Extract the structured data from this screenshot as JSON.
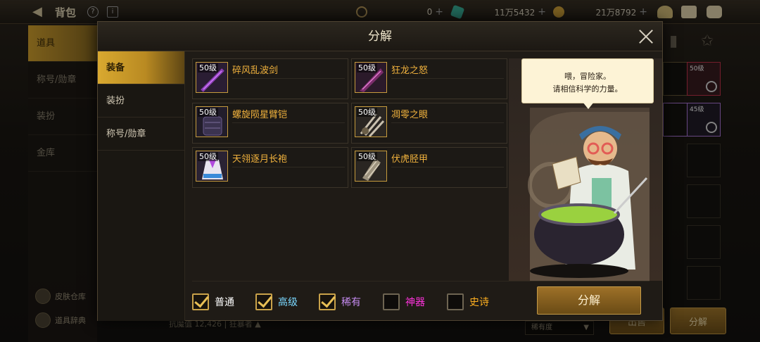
{
  "background": {
    "bag_title": "背包",
    "currency": [
      {
        "value": "0",
        "icon": "crescent-coin-icon",
        "color": "#b89a5a"
      },
      {
        "value": "11万5432",
        "icon": "green-gem-icon",
        "color": "#3ab39b"
      },
      {
        "value": "21万8792",
        "icon": "gold-coin-icon",
        "color": "#d6a53a"
      }
    ],
    "left_nav": [
      "道具",
      "称号/勋章",
      "装扮",
      "金库"
    ],
    "left_nav_bottom": [
      "皮肤仓库",
      "道具辞典"
    ],
    "right_cell_levels": [
      "50级",
      "45级"
    ],
    "bottom_stat": "抗魔值 12,426",
    "bottom_link": "狂暴者",
    "sort_select": "稀有度",
    "bottom_buttons": [
      "出售",
      "分解"
    ]
  },
  "dialog": {
    "title": "分解",
    "side_tabs": [
      {
        "label": "装备",
        "active": true
      },
      {
        "label": "装扮",
        "active": false
      },
      {
        "label": "称号/勋章",
        "active": false
      }
    ],
    "items": [
      {
        "level": "50级",
        "name": "碎风乱波剑",
        "icon": "sword-icon"
      },
      {
        "level": "50级",
        "name": "狂龙之怒",
        "icon": "blade-icon"
      },
      {
        "level": "50级",
        "name": "螺旋陨星臂铠",
        "icon": "gauntlet-icon"
      },
      {
        "level": "50级",
        "name": "凋零之眼",
        "icon": "claw-icon"
      },
      {
        "level": "50级",
        "name": "天翎逐月长袍",
        "icon": "robe-icon"
      },
      {
        "level": "50级",
        "name": "伏虎胫甲",
        "icon": "greaves-icon"
      }
    ],
    "filters": [
      {
        "label": "普通",
        "checked": true,
        "color": "#ffffff"
      },
      {
        "label": "高级",
        "checked": true,
        "color": "#7ad8ff"
      },
      {
        "label": "稀有",
        "checked": true,
        "color": "#c58bf0"
      },
      {
        "label": "神器",
        "checked": false,
        "color": "#ff33dd"
      },
      {
        "label": "史诗",
        "checked": false,
        "color": "#ffb020"
      }
    ],
    "decompose_label": "分解",
    "npc_speech_line1": "喂，冒险家。",
    "npc_speech_line2": "请相信科学的力量。"
  }
}
